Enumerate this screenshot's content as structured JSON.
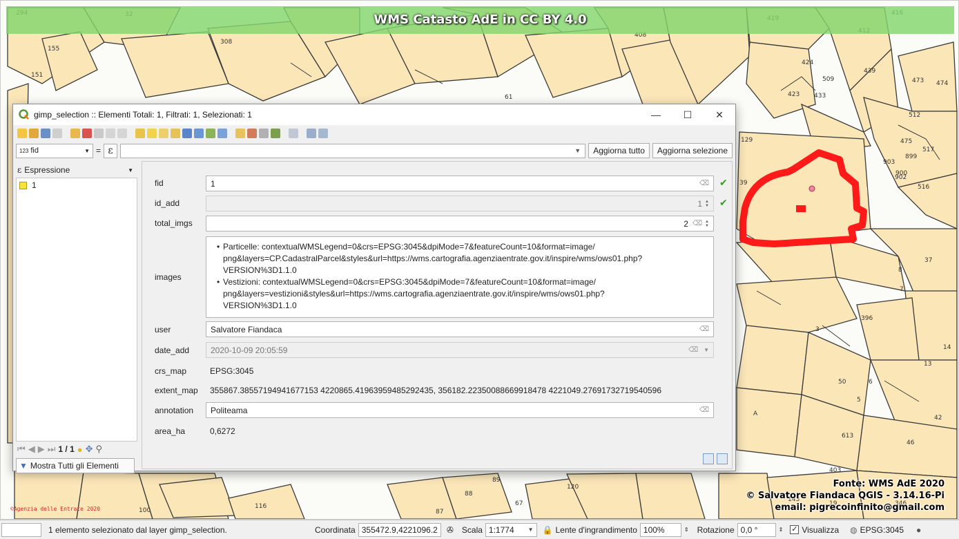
{
  "map": {
    "title": "WMS Catasto AdE in CC BY 4.0",
    "credits": [
      "Fonte: WMS AdE 2020",
      "© Salvatore Fiandaca QGIS - 3.14.16-Pi",
      "email: pigrecoinfinito@gmail.com"
    ],
    "watermark": "©Agenzia delle Entrate 2020",
    "parcel_numbers": [
      "294",
      "32",
      "155",
      "151",
      "308",
      "408",
      "419",
      "416",
      "412",
      "424",
      "509",
      "439",
      "473",
      "474",
      "512",
      "433",
      "423",
      "475",
      "517",
      "903",
      "900",
      "899",
      "902",
      "516",
      "129",
      "39",
      "8",
      "37",
      "396",
      "7",
      "3",
      "6",
      "13",
      "50",
      "5",
      "42",
      "14",
      "A",
      "61",
      "613",
      "46",
      "89",
      "88",
      "116",
      "100",
      "87",
      "67",
      "143",
      "346",
      "19",
      "403",
      "120"
    ],
    "colors": {
      "parcel_fill": "#fbe6b8",
      "parcel_stroke": "#3a3a3a",
      "selection": "#ff1a1a",
      "title_bg": "#84d66e"
    }
  },
  "window": {
    "title": "gimp_selection :: Elementi Totali: 1, Filtrati: 1, Selezionati: 1",
    "controls": {
      "minimize": "—",
      "maximize": "☐",
      "close": "✕"
    }
  },
  "filterbar": {
    "field_type": "123",
    "field": "fid",
    "operator": "=",
    "expression_symbol": "ε",
    "update_all": "Aggiorna tutto",
    "update_selection": "Aggiorna selezione"
  },
  "list": {
    "header": "Espressione",
    "items": [
      "1"
    ],
    "pages": "1 / 1",
    "show_all": "Mostra Tutti gli Elementi"
  },
  "form": {
    "fid": {
      "label": "fid",
      "value": "1"
    },
    "id_add": {
      "label": "id_add",
      "value": "1"
    },
    "total_imgs": {
      "label": "total_imgs",
      "value": "2"
    },
    "images": {
      "label": "images",
      "lines": [
        [
          "Particelle: contextualWMSLegend=0&crs=EPSG:3045&dpiMode=7&featureCount=10&format=image/",
          "png&layers=CP.CadastralParcel&styles&url=https://wms.cartografia.agenziaentrate.gov.it/inspire/wms/ows01.php?",
          "VERSION%3D1.1.0"
        ],
        [
          "Vestizioni: contextualWMSLegend=0&crs=EPSG:3045&dpiMode=7&featureCount=10&format=image/",
          "png&layers=vestizioni&styles&url=https://wms.cartografia.agenziaentrate.gov.it/inspire/wms/ows01.php?",
          "VERSION%3D1.1.0"
        ]
      ]
    },
    "user": {
      "label": "user",
      "value": "Salvatore Fiandaca"
    },
    "date_add": {
      "label": "date_add",
      "value": "2020-10-09 20:05:59"
    },
    "crs_map": {
      "label": "crs_map",
      "value": "EPSG:3045"
    },
    "extent_map": {
      "label": "extent_map",
      "value": "355867.38557194941677153 4220865.41963959485292435, 356182.22350088669918478 4221049.27691732719540596"
    },
    "annotation": {
      "label": "annotation",
      "value": "Politeama"
    },
    "area_ha": {
      "label": "area_ha",
      "value": "0,6272"
    }
  },
  "statusbar": {
    "message": "1 elemento selezionato dal layer gimp_selection.",
    "coord_label": "Coordinata",
    "coord_value": "355472.9,4221096.2",
    "scale_label": "Scala",
    "scale_value": "1:1774",
    "magnifier_label": "Lente d'ingrandimento",
    "magnifier_value": "100%",
    "rotation_label": "Rotazione",
    "rotation_value": "0,0 °",
    "render_label": "Visualizza",
    "crs": "EPSG:3045"
  }
}
